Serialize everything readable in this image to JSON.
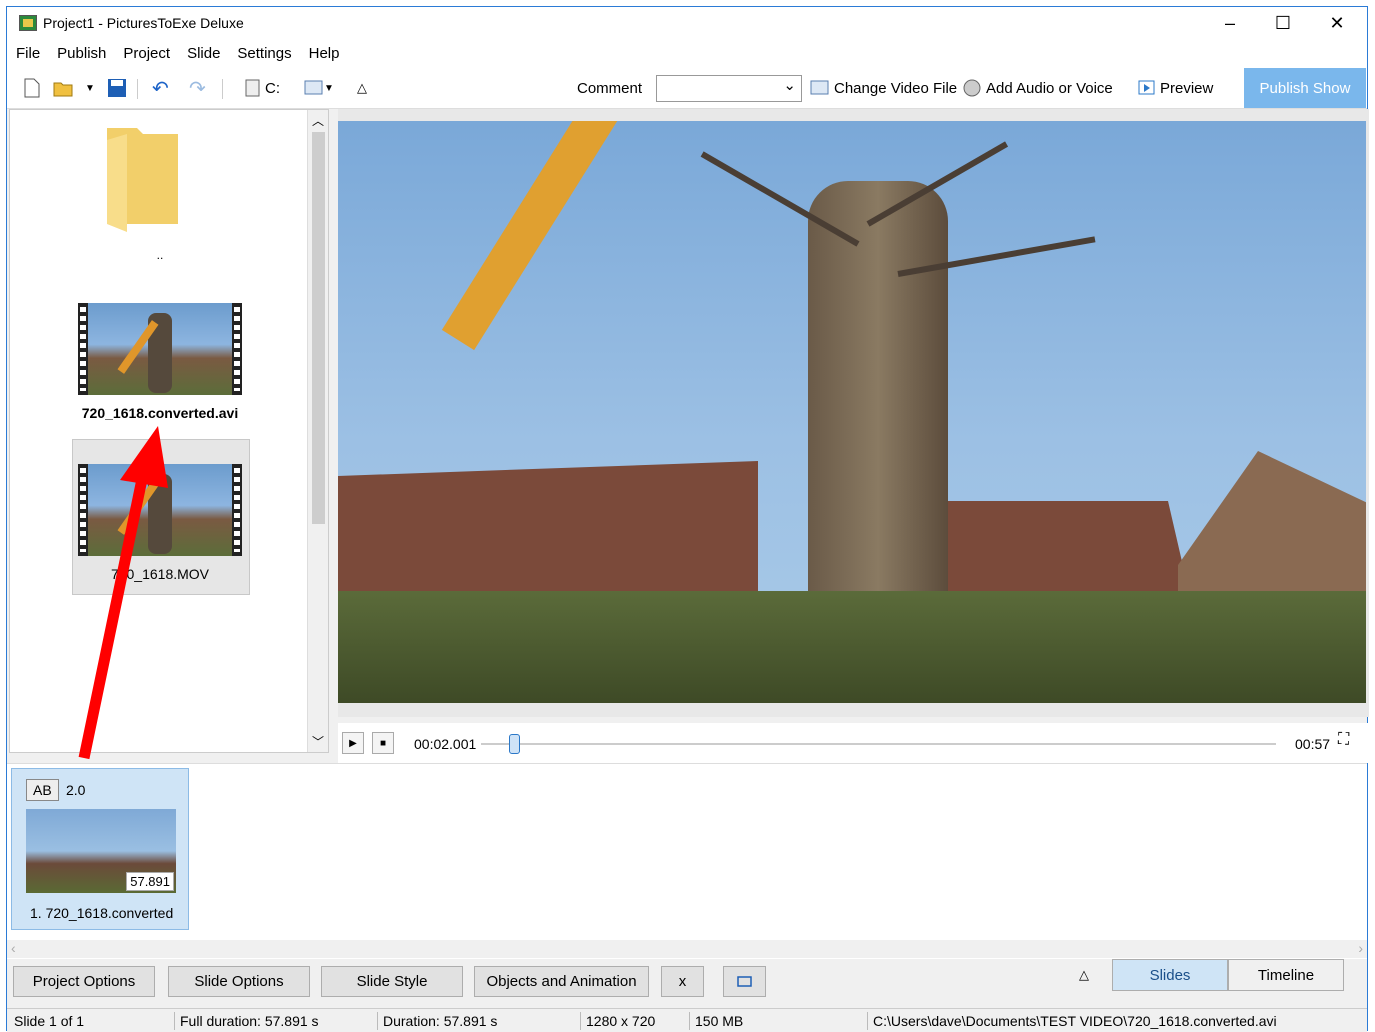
{
  "window": {
    "title": "Project1 - PicturesToExe Deluxe"
  },
  "menu": [
    "File",
    "Publish",
    "Project",
    "Slide",
    "Settings",
    "Help"
  ],
  "toolbar": {
    "drive_label": "C:",
    "comment_label": "Comment",
    "comment_value": "",
    "change_video_label": "Change Video File",
    "add_audio_label": "Add Audio or Voice",
    "preview_label": "Preview",
    "publish_label": "Publish Show"
  },
  "browser": {
    "parent_folder_label": "..",
    "files": [
      {
        "name": "720_1618.converted.avi",
        "selected": false
      },
      {
        "name": "720_1618.MOV",
        "selected": true
      }
    ]
  },
  "player": {
    "current_time": "00:02.001",
    "total_time": "00:57",
    "position": 0.035
  },
  "slides": [
    {
      "transition_icon": "AB",
      "transition_duration": "2.0",
      "duration": "57.891",
      "name": "1. 720_1618.converted"
    }
  ],
  "bottom": {
    "buttons": [
      "Project Options",
      "Slide Options",
      "Slide Style",
      "Objects and Animation",
      "x"
    ],
    "tabs": {
      "slides": "Slides",
      "timeline": "Timeline"
    }
  },
  "status": {
    "slide": "Slide 1 of 1",
    "full_duration": "Full duration: 57.891 s",
    "duration": "Duration: 57.891 s",
    "resolution": "1280 x 720",
    "size": "150 MB",
    "path": "C:\\Users\\dave\\Documents\\TEST VIDEO\\720_1618.converted.avi"
  },
  "colors": {
    "accent": "#7ab7ec",
    "selection": "#cfe4f6",
    "annotation_arrow": "#ff0000"
  }
}
